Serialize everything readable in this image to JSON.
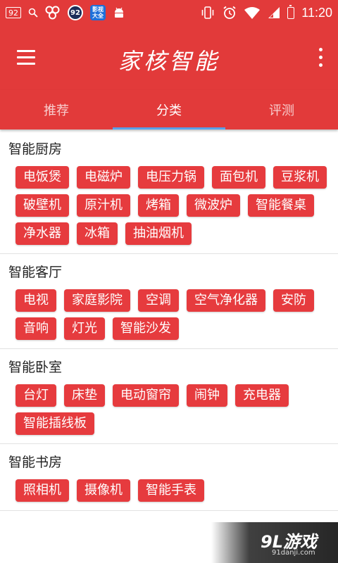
{
  "status_bar": {
    "box_badge": "92",
    "circle_badge": "92",
    "app_badge": "影视大全",
    "time": "11:20"
  },
  "toolbar": {
    "title": "家核智能"
  },
  "tabs": [
    {
      "label": "推荐"
    },
    {
      "label": "分类"
    },
    {
      "label": "评测"
    }
  ],
  "sections": [
    {
      "title": "智能厨房",
      "tags": [
        "电饭煲",
        "电磁炉",
        "电压力锅",
        "面包机",
        "豆浆机",
        "破壁机",
        "原汁机",
        "烤箱",
        "微波炉",
        "智能餐桌",
        "净水器",
        "冰箱",
        "抽油烟机"
      ]
    },
    {
      "title": "智能客厅",
      "tags": [
        "电视",
        "家庭影院",
        "空调",
        "空气净化器",
        "安防",
        "音响",
        "灯光",
        "智能沙发"
      ]
    },
    {
      "title": "智能卧室",
      "tags": [
        "台灯",
        "床垫",
        "电动窗帘",
        "闹钟",
        "充电器",
        "智能插线板"
      ]
    },
    {
      "title": "智能书房",
      "tags": [
        "照相机",
        "摄像机",
        "智能手表"
      ]
    }
  ],
  "watermark": {
    "logo": "9L游戏",
    "url": "91danji.com"
  }
}
